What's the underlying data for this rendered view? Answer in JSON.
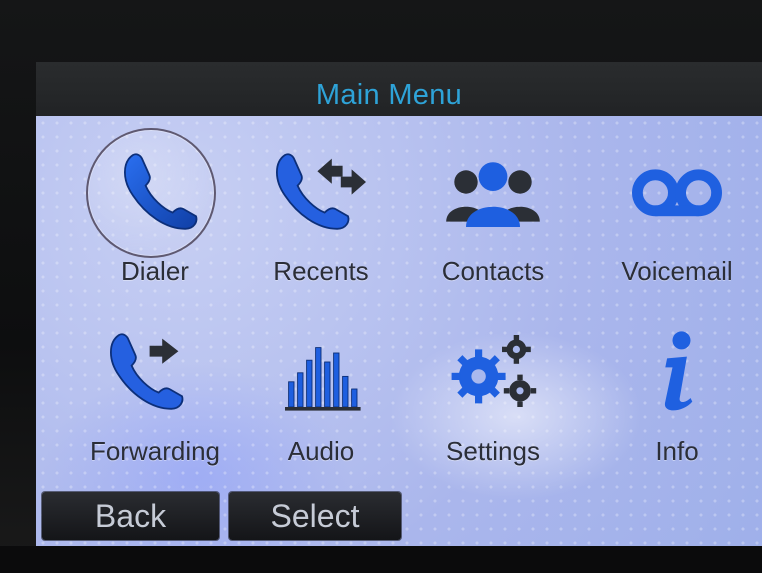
{
  "header": {
    "title": "Main Menu"
  },
  "menu": {
    "items": [
      {
        "label": "Dialer",
        "icon": "phone-icon",
        "selected": true
      },
      {
        "label": "Recents",
        "icon": "phone-arrows-icon",
        "selected": false
      },
      {
        "label": "Contacts",
        "icon": "people-group-icon",
        "selected": false
      },
      {
        "label": "Voicemail",
        "icon": "voicemail-icon",
        "selected": false
      },
      {
        "label": "Forwarding",
        "icon": "phone-forward-icon",
        "selected": false
      },
      {
        "label": "Audio",
        "icon": "equalizer-bars-icon",
        "selected": false
      },
      {
        "label": "Settings",
        "icon": "gears-icon",
        "selected": false
      },
      {
        "label": "Info",
        "icon": "info-icon",
        "selected": false
      }
    ]
  },
  "softkeys": {
    "back": "Back",
    "select": "Select"
  },
  "colors": {
    "accent": "#2ea3d8",
    "icon_blue": "#1f5fd6",
    "icon_dark": "#2b2f36"
  }
}
